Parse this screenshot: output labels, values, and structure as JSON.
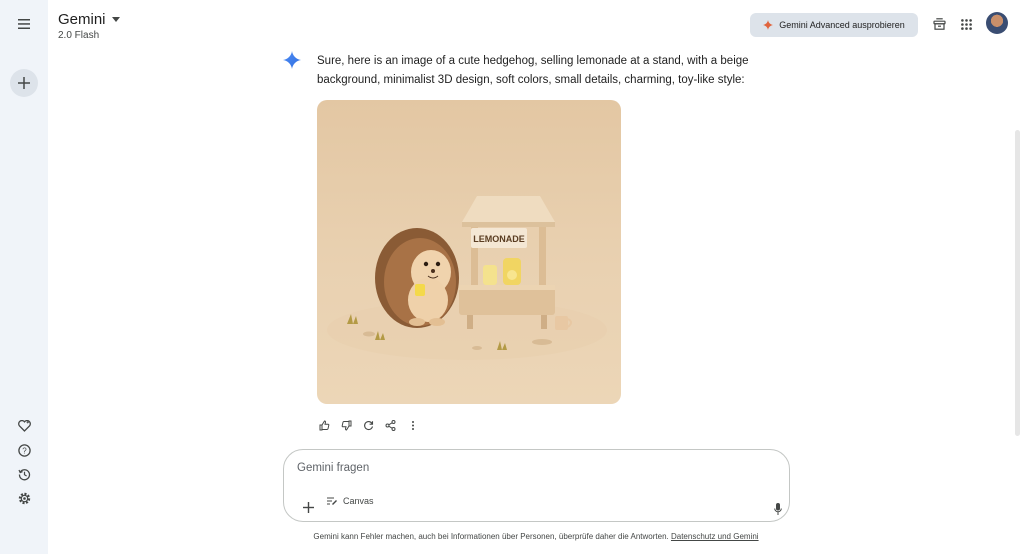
{
  "app": {
    "title": "Gemini",
    "model": "2.0 Flash",
    "advanced_label": "Gemini Advanced ausprobieren"
  },
  "icons": {
    "menu": "menu-icon",
    "new_chat": "plus-icon",
    "gem": "gem-heart-icon",
    "help": "help-icon",
    "activity": "history-icon",
    "settings": "settings-icon",
    "spark": "gemini-spark-icon"
  },
  "message": {
    "text": "Sure, here is an image of a cute hedgehog, selling lemonade at a stand, with a beige background, minimalist 3D design, soft colors, small details, charming, toy-like style:",
    "image_sign": "LEMONADE"
  },
  "input": {
    "placeholder": "Gemini fragen",
    "canvas_label": "Canvas"
  },
  "footer": {
    "text": "Gemini kann Fehler machen, auch bei Informationen über Personen, überprüfe daher die Antworten. ",
    "link": "Datenschutz und Gemini"
  },
  "colors": {
    "sidebar_bg": "#f0f4f9",
    "advanced_btn_bg": "#dde3ea",
    "spark_blue": "#4285f4",
    "advanced_star": "#e0643d"
  }
}
